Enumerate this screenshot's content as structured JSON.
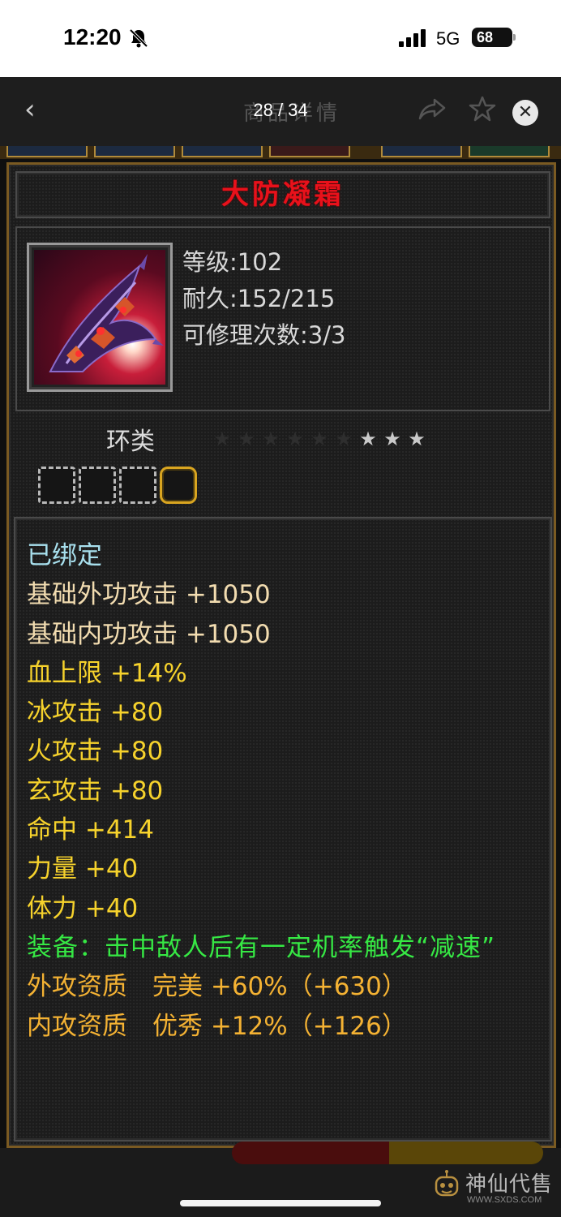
{
  "status_bar": {
    "time": "12:20",
    "network": "5G",
    "battery": "68",
    "icons": [
      "bell-muted-icon",
      "signal-icon",
      "battery-icon"
    ]
  },
  "nav": {
    "title_partial": "商品详情",
    "counter": "28 / 34",
    "icons": [
      "back-arrow-icon",
      "share-icon",
      "star-icon",
      "close-icon"
    ]
  },
  "item": {
    "name": "大防凝霜",
    "level_label": "等级",
    "level_value": "102",
    "durability_label": "耐久",
    "durability_value": "152/215",
    "repair_label": "可修理次数",
    "repair_value": "3/3",
    "category": "环类",
    "stars_total": 9,
    "stars_lit": 3,
    "socket_count": 4,
    "socket_gold_index": 3
  },
  "attributes": {
    "bound": "已绑定",
    "base_ext": "基础外功攻击 +1050",
    "base_int": "基础内功攻击 +1050",
    "hp": "血上限 +14%",
    "ice": "冰攻击 +80",
    "fire": "火攻击 +80",
    "mystic": "玄攻击 +80",
    "hit": "命中 +414",
    "strength": "力量 +40",
    "stamina": "体力 +40",
    "equip_effect": "装备：击中敌人后有一定机率触发“减速”",
    "ext_quality": "外攻资质　完美 +60%（+630）",
    "int_quality": "内攻资质　优秀 +12%（+126）"
  },
  "watermark": {
    "text": "神仙代售",
    "url": "WWW.SXDS.COM"
  },
  "colors": {
    "item_name": "#e8111b",
    "bound": "#a8e0ee",
    "base": "#f2dcb0",
    "yellow": "#f6d22c",
    "green": "#36e844",
    "orange": "#f4b233",
    "frame_gold": "#7a5a22"
  }
}
